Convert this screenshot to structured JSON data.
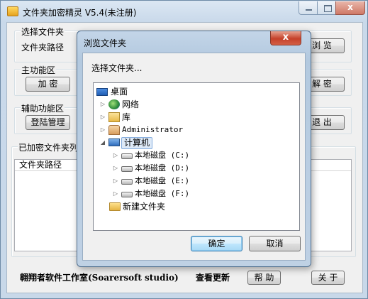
{
  "window": {
    "title": "文件夹加密精灵 V5.4(未注册)",
    "controls": {
      "minimize": "",
      "maximize": "",
      "close": "x"
    }
  },
  "groups": {
    "select_folder": {
      "legend": "选择文件夹",
      "path_label": "文件夹路径",
      "browse_button": "浏  览"
    },
    "main_functions": {
      "legend": "主功能区",
      "encrypt_button": "加  密",
      "decrypt_button": "解  密"
    },
    "aux_functions": {
      "legend": "辅助功能区",
      "login_button": "登陆管理",
      "exit_button": "退  出"
    },
    "encrypted_list": {
      "legend": "已加密文件夹列表",
      "column_header": "文件夹路径"
    }
  },
  "footer": {
    "studio": "翱翔者软件工作室(Soarersoft studio)",
    "check_update": "查看更新",
    "help_button": "帮 助",
    "about_button": "关 于"
  },
  "dialog": {
    "title": "浏览文件夹",
    "close": "x",
    "prompt": "选择文件夹...",
    "tree": [
      {
        "label": "桌面",
        "icon": "desktop-icon",
        "arrow": ""
      },
      {
        "label": "网络",
        "icon": "network-icon",
        "arrow": "▷"
      },
      {
        "label": "库",
        "icon": "library-icon",
        "arrow": "▷"
      },
      {
        "label": "Administrator",
        "icon": "user-folder-icon",
        "arrow": "▷"
      },
      {
        "label": "计算机",
        "icon": "computer-icon",
        "arrow": "◢"
      },
      {
        "label": "本地磁盘 (C:)",
        "icon": "drive-icon",
        "arrow": "▷"
      },
      {
        "label": "本地磁盘 (D:)",
        "icon": "drive-icon",
        "arrow": "▷"
      },
      {
        "label": "本地磁盘 (E:)",
        "icon": "drive-icon",
        "arrow": "▷"
      },
      {
        "label": "本地磁盘 (F:)",
        "icon": "drive-icon",
        "arrow": "▷"
      },
      {
        "label": "新建文件夹",
        "icon": "folder-icon",
        "arrow": ""
      }
    ],
    "ok_button": "确定",
    "cancel_button": "取消"
  }
}
